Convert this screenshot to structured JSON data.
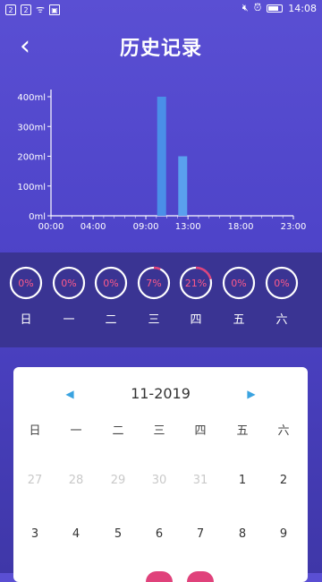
{
  "status": {
    "left_icons": [
      "2",
      "2"
    ],
    "time": "14:08"
  },
  "header": {
    "title": "历史记录"
  },
  "chart_data": {
    "type": "bar",
    "ylabel_ticks": [
      "0ml",
      "100ml",
      "200ml",
      "300ml",
      "400ml"
    ],
    "xlabel_ticks": [
      "00:00",
      "04:00",
      "09:00",
      "13:00",
      "18:00",
      "23:00"
    ],
    "bars": [
      {
        "x": 10.5,
        "value": 400
      },
      {
        "x": 12.5,
        "value": 200
      }
    ],
    "ylim": [
      0,
      400
    ],
    "xlim": [
      0,
      23
    ],
    "colors": {
      "bar1": "#4a8fe8",
      "bar2": "#5aa0ee",
      "axis": "#ffffff"
    }
  },
  "week": [
    {
      "pct": "0%",
      "value": 0,
      "day": "日"
    },
    {
      "pct": "0%",
      "value": 0,
      "day": "一"
    },
    {
      "pct": "0%",
      "value": 0,
      "day": "二"
    },
    {
      "pct": "7%",
      "value": 7,
      "day": "三"
    },
    {
      "pct": "21%",
      "value": 21,
      "day": "四"
    },
    {
      "pct": "0%",
      "value": 0,
      "day": "五"
    },
    {
      "pct": "0%",
      "value": 0,
      "day": "六"
    }
  ],
  "calendar": {
    "month": "11-2019",
    "weekdays": [
      "日",
      "一",
      "二",
      "三",
      "四",
      "五",
      "六"
    ],
    "rows": [
      [
        "27",
        "28",
        "29",
        "30",
        "31",
        "1",
        "2"
      ],
      [
        "3",
        "4",
        "5",
        "6",
        "7",
        "8",
        "9"
      ]
    ],
    "muted_first_row_count": 5,
    "accent": "#e0427b"
  }
}
